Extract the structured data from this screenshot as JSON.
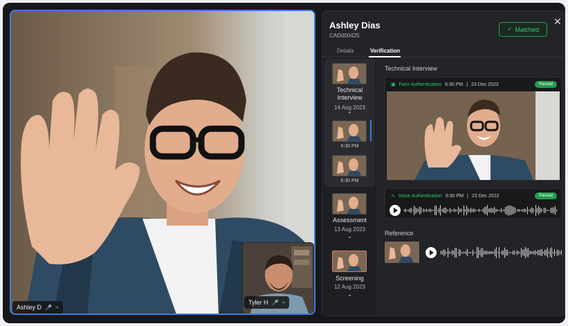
{
  "participants": {
    "main": {
      "name": "Ashley D"
    },
    "pip": {
      "name": "Tyler H"
    }
  },
  "candidate": {
    "name": "Ashley Dias",
    "id": "CAD000425",
    "status": "Matched"
  },
  "tabs": [
    {
      "label": "Details",
      "active": false
    },
    {
      "label": "Verification",
      "active": true
    }
  ],
  "sessions": [
    {
      "label": "Technical Interview",
      "date": "14 Aug 2023",
      "clips": [
        "6:30 PM",
        "6:30 PM"
      ]
    },
    {
      "label": "Assessment",
      "date": "13 Aug 2023"
    },
    {
      "label": "Screening",
      "date": "12 Aug 2023"
    }
  ],
  "detail": {
    "section_title": "Technical Interview",
    "face": {
      "label": "Face Authentication",
      "time": "6:30 PM",
      "separator": "|",
      "date": "23 Dec 2022",
      "status": "Passed"
    },
    "voice": {
      "label": "Voice Authentication",
      "time": "6:30 PM",
      "separator": "|",
      "date": "23 Dec 2022",
      "status": "Passed"
    },
    "reference_title": "Reference"
  },
  "icons": {
    "mic": "mic-icon",
    "wifi": "wifi-icon",
    "close": "close-icon",
    "check": "check-icon",
    "chevron": "chevron-icon",
    "face_scan": "face-scan-icon",
    "voice_wave": "voice-wave-icon",
    "play": "play-icon"
  },
  "colors": {
    "accent_blue": "#3b7de0",
    "success_green": "#2ecc71",
    "panel_bg": "#232427",
    "selected_thumb": "#e07a5f"
  }
}
